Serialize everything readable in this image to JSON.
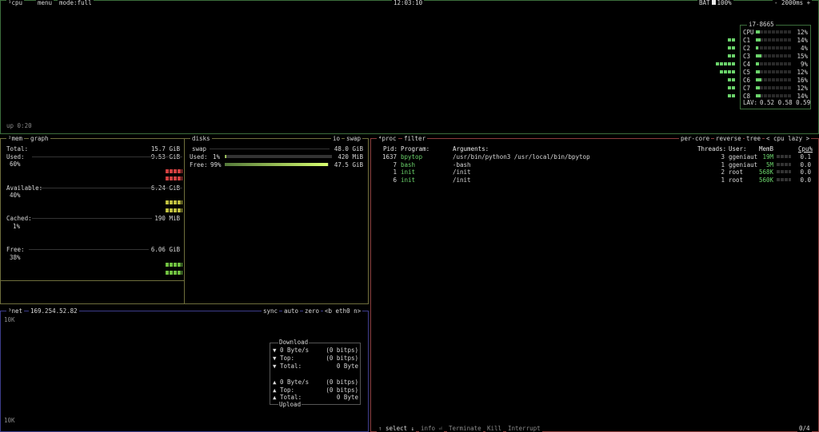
{
  "cpu": {
    "tab": "cpu",
    "menu": "menu",
    "mode": "mode:full",
    "clock": "12:03:10",
    "battery_label": "BAT",
    "battery_pct": "100%",
    "update": "- 2000ms +",
    "uptime": "up 0:20",
    "model": "i7-8665",
    "cores": [
      {
        "name": "CPU",
        "pct": "12%",
        "level": 0.12
      },
      {
        "name": "C1",
        "pct": "14%",
        "level": 0.14
      },
      {
        "name": "C2",
        "pct": "4%",
        "level": 0.04
      },
      {
        "name": "C3",
        "pct": "15%",
        "level": 0.15
      },
      {
        "name": "C4",
        "pct": "9%",
        "level": 0.09
      },
      {
        "name": "C5",
        "pct": "12%",
        "level": 0.12
      },
      {
        "name": "C6",
        "pct": "16%",
        "level": 0.16
      },
      {
        "name": "C7",
        "pct": "12%",
        "level": 0.12
      },
      {
        "name": "C8",
        "pct": "14%",
        "level": 0.14
      }
    ],
    "lav_label": "LAV:",
    "lav": "0.52 0.58 0.59",
    "colors": {
      "border": "#3c6e3c",
      "accent": "#6bd46b"
    }
  },
  "mem": {
    "tab": "mem",
    "graph": "graph",
    "total_label": "Total:",
    "total": "15.7 GiB",
    "used_label": "Used:",
    "used": "9.53 GiB",
    "used_pct": "60%",
    "avail_label": "Available:",
    "avail": "6.24 GiB",
    "avail_pct": "40%",
    "cached_label": "Cached:",
    "cached": "190 MiB",
    "cached_pct": "1%",
    "free_label": "Free:",
    "free": "6.06 GiB",
    "free_pct": "38%",
    "colors": {
      "border": "#6e6e3c",
      "used": "#d04040",
      "avail": "#c0c040",
      "free": "#70c040"
    }
  },
  "disks": {
    "tab": "disks",
    "io": "io",
    "swap": "swap",
    "swap_label": "swap",
    "swap_total": "48.0 GiB",
    "used_label": "Used:",
    "used_pct": "1%",
    "used_val": "420 MiB",
    "used_level": 0.01,
    "free_label": "Free:",
    "free_pct": "99%",
    "free_val": "47.5 GiB",
    "free_level": 0.99
  },
  "net": {
    "tab": "net",
    "ip": "169.254.52.82",
    "sync": "sync",
    "auto": "auto",
    "zero": "zero",
    "iface": "<b eth0 n>",
    "scale_top": "10K",
    "scale_bottom": "10K",
    "download": "Download",
    "upload": "Upload",
    "rows": [
      {
        "arrow": "▼",
        "label": "0 Byte/s",
        "val": "(0 bitps)"
      },
      {
        "arrow": "▼",
        "label": "Top:",
        "val": "(0 bitps)"
      },
      {
        "arrow": "▼",
        "label": "Total:",
        "val": "0 Byte"
      },
      {
        "arrow": "▲",
        "label": "0 Byte/s",
        "val": "(0 bitps)"
      },
      {
        "arrow": "▲",
        "label": "Top:",
        "val": "(0 bitps)"
      },
      {
        "arrow": "▲",
        "label": "Total:",
        "val": "0 Byte"
      }
    ],
    "colors": {
      "border": "#3c3c8a"
    }
  },
  "proc": {
    "tab": "proc",
    "filter": "filter",
    "per_core": "per-core",
    "reverse": "reverse",
    "tree": "tree",
    "sort": "< cpu lazy >",
    "headers": {
      "pid": "Pid:",
      "program": "Program:",
      "args": "Arguments:",
      "threads": "Threads:",
      "user": "User:",
      "mem": "MemB",
      "cpu": "Cpu%"
    },
    "rows": [
      {
        "pid": "1637",
        "program": "bpytop",
        "args": "/usr/bin/python3 /usr/local/bin/bpytop",
        "threads": "3",
        "user": "ggeniaut",
        "mem": "19M",
        "cpu": "0.1"
      },
      {
        "pid": "7",
        "program": "bash",
        "args": "-bash",
        "threads": "1",
        "user": "ggeniaut",
        "mem": "5M",
        "cpu": "0.0"
      },
      {
        "pid": "1",
        "program": "init",
        "args": "/init",
        "threads": "2",
        "user": "root",
        "mem": "568K",
        "cpu": "0.0"
      },
      {
        "pid": "6",
        "program": "init",
        "args": "/init",
        "threads": "1",
        "user": "root",
        "mem": "560K",
        "cpu": "0.0"
      }
    ],
    "footer": {
      "select": "select",
      "info": "info",
      "terminate": "Terminate",
      "kill": "Kill",
      "interrupt": "Interrupt",
      "count": "0/4"
    },
    "colors": {
      "border": "#8a3c3c"
    }
  }
}
